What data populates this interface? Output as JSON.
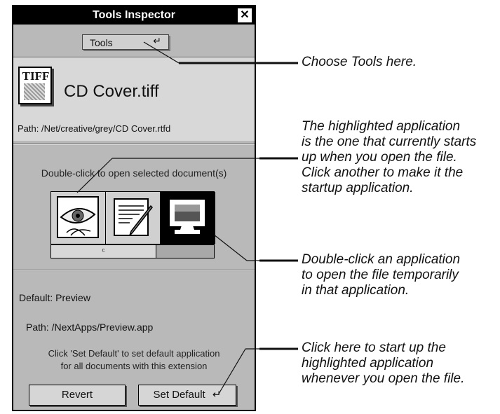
{
  "window": {
    "title": "Tools Inspector",
    "close_glyph": "✕"
  },
  "popup": {
    "label": "Tools",
    "arrow": "↵"
  },
  "file": {
    "icon_text": "TIFF",
    "name": "CD Cover.tiff",
    "path": "Path:  /Net/creative/grey/CD Cover.rtfd"
  },
  "apps_section": {
    "instruction": "Double-click to open selected document(s)",
    "apps": [
      {
        "icon": "preview-eye-icon",
        "selected": false
      },
      {
        "icon": "edit-document-icon",
        "selected": false
      },
      {
        "icon": "monitor-icon",
        "selected": true
      }
    ],
    "scroll_glyph": "ᶜ"
  },
  "default": {
    "label": "Default: Preview",
    "path": "Path:  /NextApps/Preview.app"
  },
  "help_text_1": "Click 'Set Default' to set default application",
  "help_text_2": "for all documents with this extension",
  "buttons": {
    "revert": "Revert",
    "set_default": "Set Default",
    "set_default_glyph": "↵"
  },
  "annotations": [
    {
      "id": "choose-tools",
      "lines": [
        "Choose Tools here."
      ]
    },
    {
      "id": "highlighted-app",
      "lines": [
        "The highlighted application",
        "is the one that currently starts",
        "up when you open the file.",
        "Click another to make it the",
        "startup application."
      ]
    },
    {
      "id": "double-click",
      "lines": [
        "Double-click an application",
        "to open the file temporarily",
        "in that application."
      ]
    },
    {
      "id": "click-here",
      "lines": [
        "Click here to start up the",
        "highlighted application",
        "whenever you open the file."
      ]
    }
  ]
}
